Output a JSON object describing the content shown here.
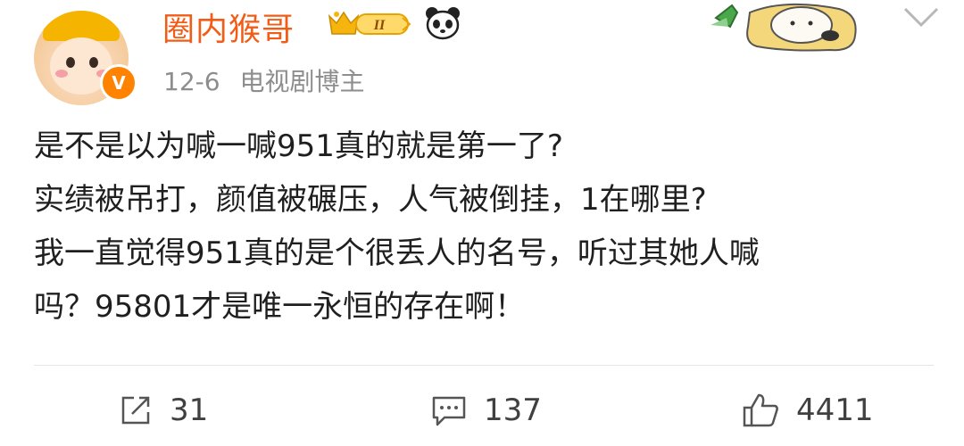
{
  "post": {
    "author": "圈内猴哥",
    "level_badge": "II",
    "verified_mark": "V",
    "date": "12-6",
    "tag": "电视剧博主",
    "lines": [
      "是不是以为喊一喊951真的就是第一了?",
      "实绩被吊打，颜值被碾压，人气被倒挂，1在哪里?",
      "我一直觉得951真的是个很丢人的名号，听过其她人喊",
      "吗？95801才是唯一永恒的存在啊！"
    ]
  },
  "actions": {
    "repost_count": "31",
    "comment_count": "137",
    "like_count": "4411"
  },
  "icons": {
    "avatar": "monkey-king-avatar",
    "badge": "crown-level-badge",
    "emoji": "panda-icon",
    "menu": "chevron-down-icon",
    "repost": "share-icon",
    "comment": "comment-icon",
    "like": "thumbs-up-icon"
  },
  "colors": {
    "author": "#f25c16",
    "meta": "#8d8d8d",
    "text": "#1f1f1f",
    "verified": "#ff8200"
  }
}
